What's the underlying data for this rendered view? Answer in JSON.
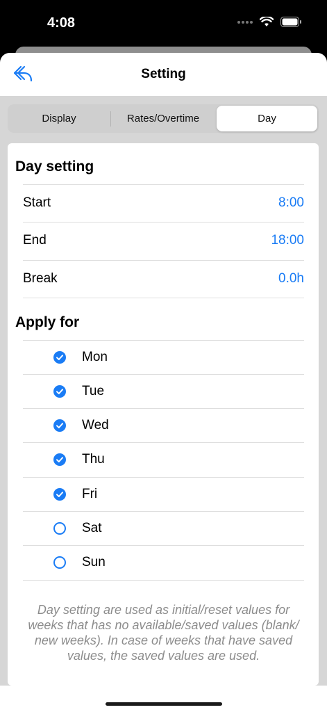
{
  "status_bar": {
    "time": "4:08"
  },
  "nav": {
    "title": "Setting"
  },
  "segments": {
    "display": "Display",
    "rates": "Rates/Overtime",
    "day": "Day",
    "selected": "Day"
  },
  "day_setting": {
    "title": "Day setting",
    "rows": [
      {
        "label": "Start",
        "value": "8:00"
      },
      {
        "label": "End",
        "value": "18:00"
      },
      {
        "label": "Break",
        "value": "0.0h"
      }
    ]
  },
  "apply_for": {
    "title": "Apply for",
    "days": [
      {
        "label": "Mon",
        "checked": true
      },
      {
        "label": "Tue",
        "checked": true
      },
      {
        "label": "Wed",
        "checked": true
      },
      {
        "label": "Thu",
        "checked": true
      },
      {
        "label": "Fri",
        "checked": true
      },
      {
        "label": "Sat",
        "checked": false
      },
      {
        "label": "Sun",
        "checked": false
      }
    ]
  },
  "footer_note": "Day setting are used as initial/reset values for weeks that has no available/saved values (blank/ new weeks). In case of weeks that have saved values, the saved values are used.",
  "colors": {
    "accent": "#1a7cf5",
    "background": "#d6d6d6"
  }
}
